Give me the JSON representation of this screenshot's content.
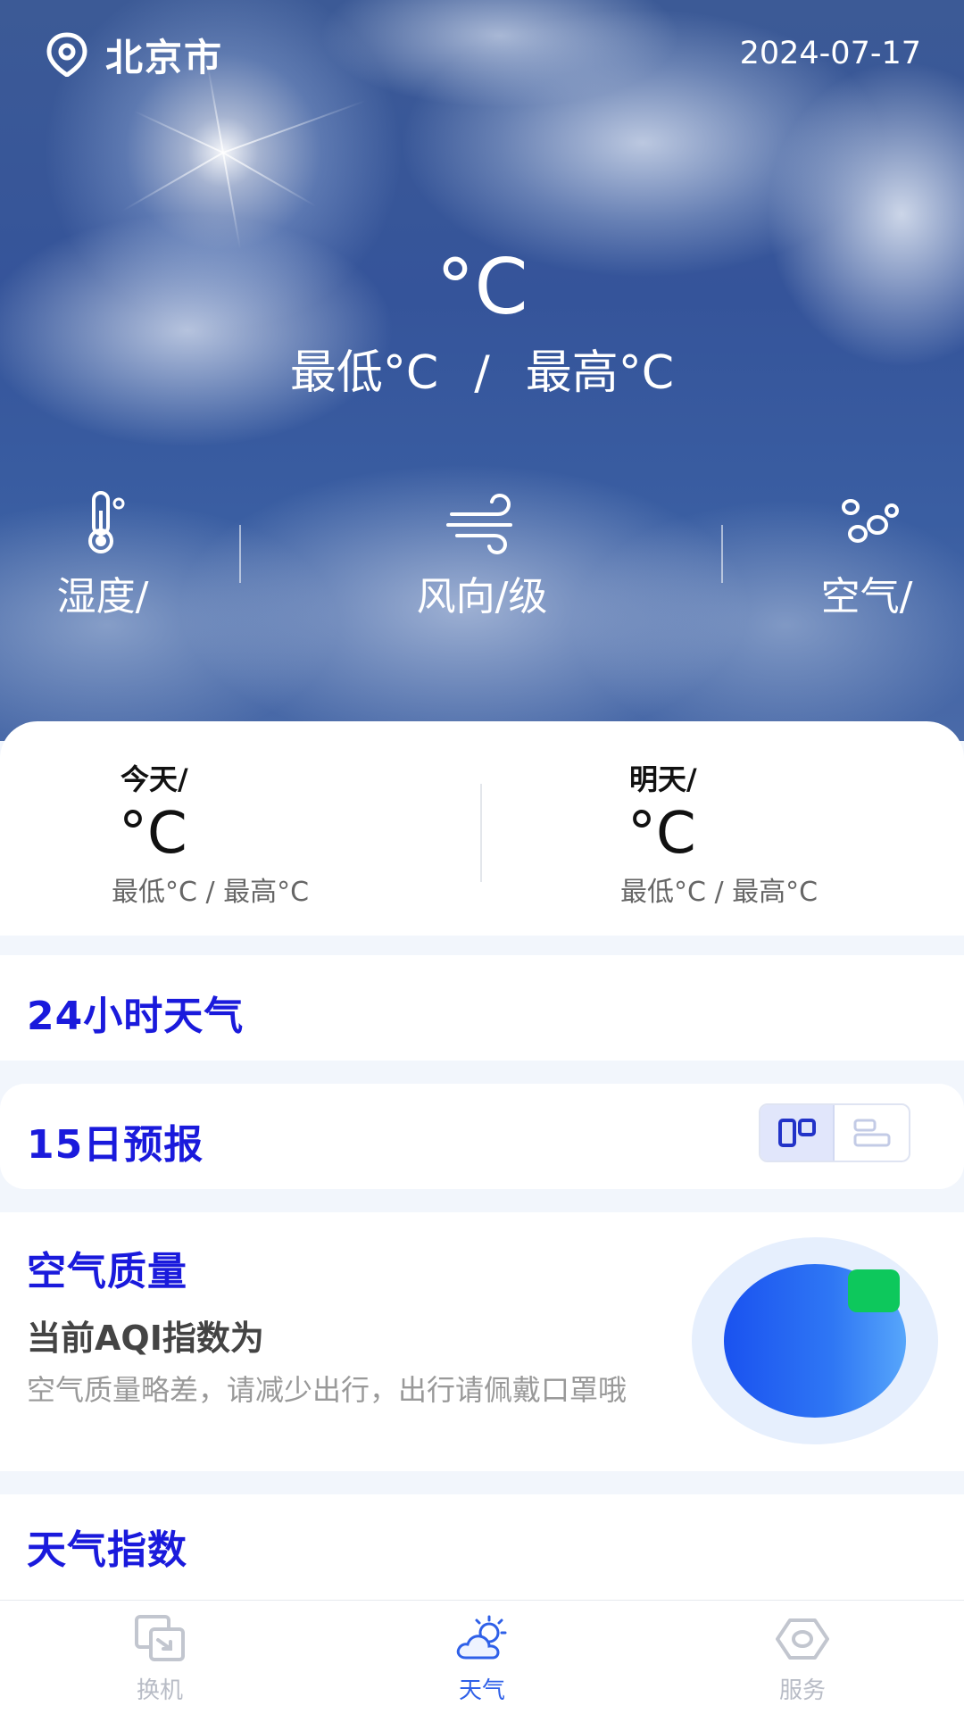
{
  "header": {
    "city": "北京市",
    "date": "2024-07-17",
    "location_icon": "location-pin-icon"
  },
  "current": {
    "temperature": "°C",
    "low": "最低°C",
    "separator": "/",
    "high": "最高°C"
  },
  "metrics": {
    "humidity": {
      "label": "湿度/",
      "icon": "thermometer-icon"
    },
    "wind": {
      "label": "风向/级",
      "icon": "wind-icon"
    },
    "air": {
      "label": "空气/",
      "icon": "air-drops-icon"
    }
  },
  "days": {
    "today": {
      "label": "今天/",
      "temp": "°C",
      "range": "最低°C / 最高°C"
    },
    "tomorrow": {
      "label": "明天/",
      "temp": "°C",
      "range": "最低°C / 最高°C"
    }
  },
  "sections": {
    "hourly_title": "24小时天气",
    "forecast_title": "15日预报",
    "forecast_view_options": [
      "card-view-icon",
      "list-view-icon"
    ],
    "air_quality": {
      "title": "空气质量",
      "aqi_text": "当前AQI指数为",
      "desc": "空气质量略差，请减少出行，出行请佩戴口罩哦",
      "badge_color": "#0dc85c"
    },
    "index_title": "天气指数"
  },
  "tabbar": {
    "items": [
      {
        "label": "换机",
        "icon": "phone-transfer-icon",
        "active": false
      },
      {
        "label": "天气",
        "icon": "cloud-sun-icon",
        "active": true
      },
      {
        "label": "服务",
        "icon": "hexagon-icon",
        "active": false
      }
    ],
    "active_color": "#2f60e8",
    "inactive_color": "#b8bcc6"
  },
  "colors": {
    "section_title": "#1a1adc",
    "aqi_ball": "#2f77f4"
  }
}
